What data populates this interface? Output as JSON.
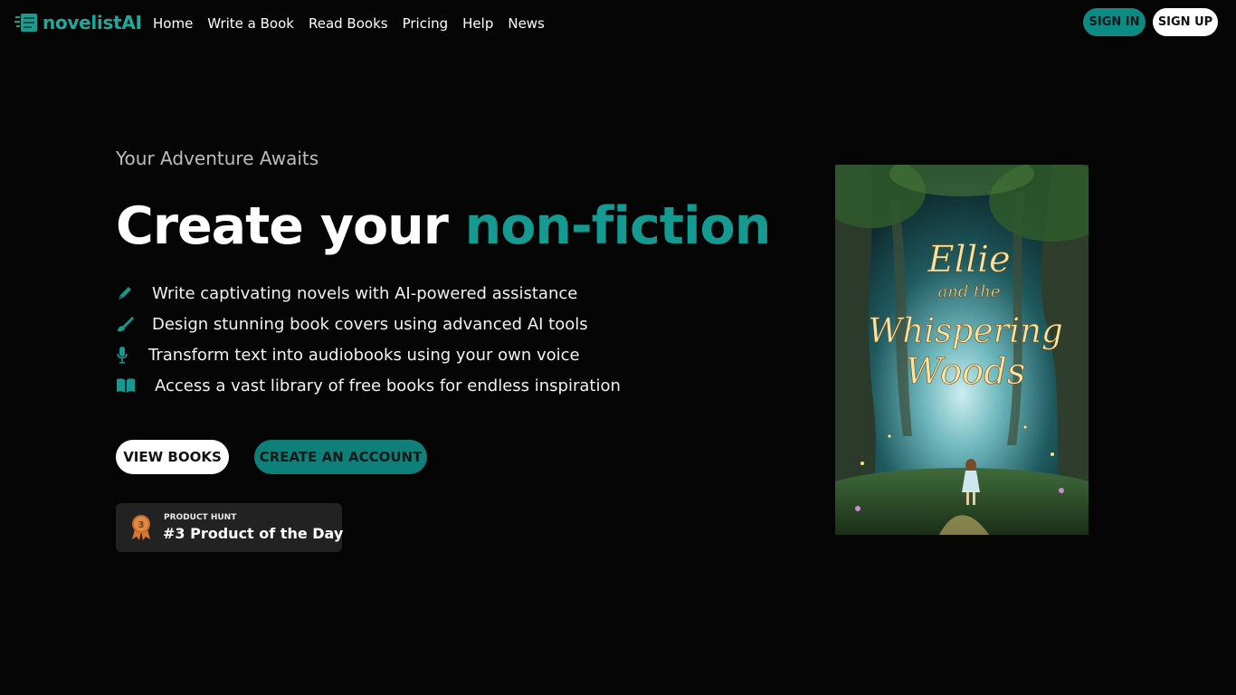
{
  "header": {
    "logo_text": "novelistAI",
    "nav": [
      "Home",
      "Write a Book",
      "Read Books",
      "Pricing",
      "Help",
      "News"
    ],
    "sign_in": "SIGN IN",
    "sign_up": "SIGN UP"
  },
  "hero": {
    "eyebrow": "Your Adventure Awaits",
    "headline_prefix": "Create your ",
    "headline_accent": "non-fiction",
    "features": [
      {
        "icon": "pen-icon",
        "text": "Write captivating novels with AI-powered assistance"
      },
      {
        "icon": "brush-icon",
        "text": "Design stunning book covers using advanced AI tools"
      },
      {
        "icon": "microphone-icon",
        "text": "Transform text into audiobooks using your own voice"
      },
      {
        "icon": "open-book-icon",
        "text": "Access a vast library of free books for endless inspiration"
      }
    ],
    "view_books": "VIEW BOOKS",
    "create_account": "CREATE AN ACCOUNT"
  },
  "product_hunt": {
    "label": "PRODUCT HUNT",
    "title": "#3 Product of the Day",
    "rank": "3"
  },
  "cover": {
    "title_line1": "Ellie",
    "title_line2": "and the",
    "title_line3": "Whispering",
    "title_line4": "Woods"
  },
  "colors": {
    "accent": "#149a91",
    "background": "#050505",
    "badge": "#222222"
  }
}
